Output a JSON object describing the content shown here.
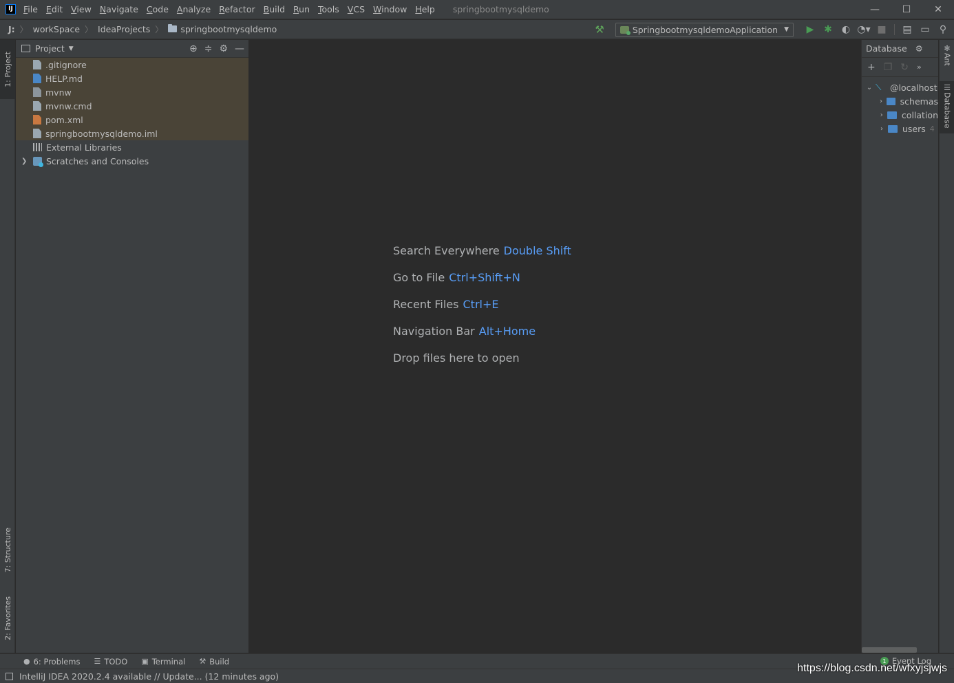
{
  "menubar": {
    "app_icon": "IJ",
    "items": [
      "File",
      "Edit",
      "View",
      "Navigate",
      "Code",
      "Analyze",
      "Refactor",
      "Build",
      "Run",
      "Tools",
      "VCS",
      "Window",
      "Help"
    ],
    "window_title": "springbootmysqldemo",
    "controls": {
      "minimize": "—",
      "maximize": "☐",
      "close": "✕"
    }
  },
  "navbar": {
    "crumbs": [
      "J:",
      "workSpace",
      "IdeaProjects",
      "springbootmysqldemo"
    ],
    "run_config": "SpringbootmysqldemoApplication"
  },
  "left_stripe": {
    "project_tab": "1: Project",
    "structure_tab": "7: Structure",
    "favorites_tab": "2: Favorites"
  },
  "project_panel": {
    "title": "Project",
    "files": [
      {
        "name": ".gitignore",
        "icon": "file-icon"
      },
      {
        "name": "HELP.md",
        "icon": "markdown-icon"
      },
      {
        "name": "mvnw",
        "icon": "terminal-file-icon"
      },
      {
        "name": "mvnw.cmd",
        "icon": "file-icon"
      },
      {
        "name": "pom.xml",
        "icon": "xml-icon"
      },
      {
        "name": "springbootmysqldemo.iml",
        "icon": "iml-icon"
      }
    ],
    "external_libraries": "External Libraries",
    "scratches": "Scratches and Consoles"
  },
  "editor": {
    "hints": [
      {
        "label": "Search Everywhere",
        "shortcut": "Double Shift"
      },
      {
        "label": "Go to File",
        "shortcut": "Ctrl+Shift+N"
      },
      {
        "label": "Recent Files",
        "shortcut": "Ctrl+E"
      },
      {
        "label": "Navigation Bar",
        "shortcut": "Alt+Home"
      },
      {
        "label": "Drop files here to open",
        "shortcut": ""
      }
    ]
  },
  "database": {
    "title": "Database",
    "connection": "@localhost",
    "nodes": [
      {
        "name": "schemas",
        "count": ""
      },
      {
        "name": "collation",
        "count": ""
      },
      {
        "name": "users",
        "count": "4"
      }
    ]
  },
  "right_stripe": {
    "ant_tab": "Ant",
    "database_tab": "Database"
  },
  "bottom_stripe": {
    "problems": "6: Problems",
    "todo": "TODO",
    "terminal": "Terminal",
    "build": "Build",
    "event_log": "Event Log",
    "event_count": "1"
  },
  "statusbar": {
    "message": "IntelliJ IDEA 2020.2.4 available // Update... (12 minutes ago)"
  },
  "watermark": "https://blog.csdn.net/wfxyjsjwjs",
  "colors": {
    "background": "#2b2b2b",
    "panel": "#3c3f41",
    "selection": "#4a4437",
    "shortcut": "#589df6",
    "run_green": "#499c54"
  }
}
